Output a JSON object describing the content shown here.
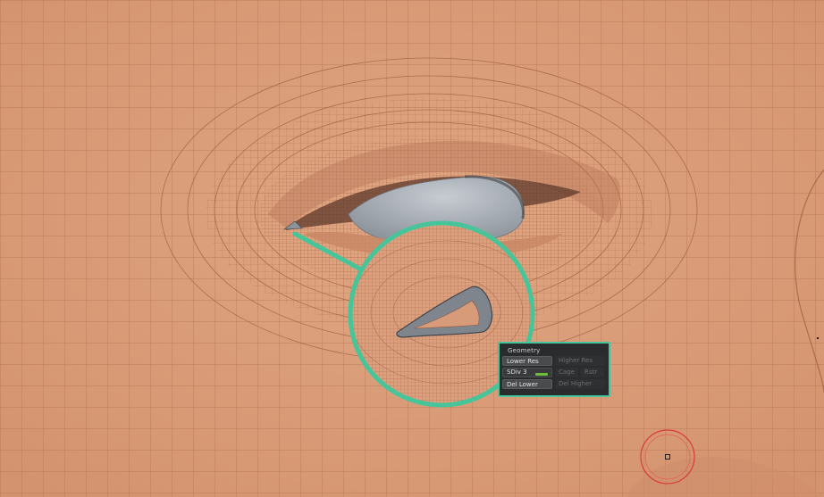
{
  "geometry_panel": {
    "title": "Geometry",
    "lower_res": "Lower Res",
    "higher_res": "Higher Res",
    "sdiv": "SDiv 3",
    "cage": "Cage",
    "rstr": "Rstr",
    "del_lower": "Del Lower",
    "del_higher": "Del Higher",
    "sdiv_level": 0.3
  },
  "colors": {
    "skin": "#d89a78",
    "wire": "#a8664a",
    "highlight_ring": "#47c59a",
    "brush_cursor": "#d83a3a",
    "eye_surface": "#aab0b8"
  },
  "icons": [
    "brush-cursor-icon"
  ]
}
